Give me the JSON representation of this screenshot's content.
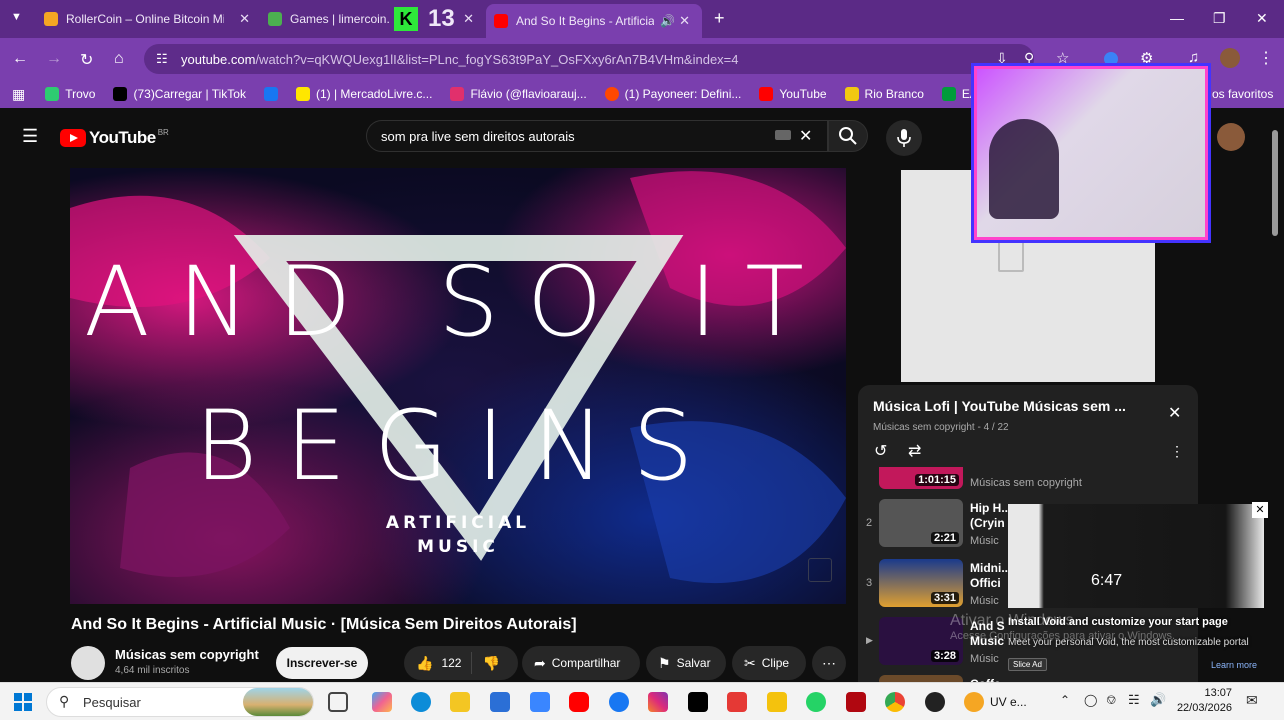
{
  "browser": {
    "tabs": [
      {
        "title": "RollerCoin – Online Bitcoin Min",
        "color": "#f5a623"
      },
      {
        "title": "Games | limercoin.c",
        "color": "#4caf50"
      },
      {
        "title": "And So It Begins - Artificial",
        "color": "#ff0000"
      }
    ],
    "overlay_counter": "13",
    "url_host": "youtube.com",
    "url_path": "/watch?v=qKWQUexg1lI&list=PLnc_fogYS63t9PaY_OsFXxy6rAn7B4VHm&index=4",
    "bookmarks": [
      {
        "label": "Trovo",
        "color": "#2ecc71"
      },
      {
        "label": "(73)Carregar | TikTok",
        "color": "#000000"
      },
      {
        "label": "",
        "color": "#1877f2"
      },
      {
        "label": "(1) | MercadoLivre.c...",
        "color": "#ffe600"
      },
      {
        "label": "Flávio (@flavioarauj...",
        "color": "#e1306c"
      },
      {
        "label": "(1) Payoneer: Defini...",
        "color": "#ff4800"
      },
      {
        "label": "YouTube",
        "color": "#ff0000"
      },
      {
        "label": "Rio Branco",
        "color": "#f2c811"
      },
      {
        "label": "EAD Cursos",
        "color": "#009c3b"
      }
    ],
    "bookmarks_right": "os favoritos"
  },
  "youtube": {
    "logo_text": "YouTube",
    "country": "BR",
    "search_query": "som pra live sem direitos autorais",
    "video_art": {
      "line1": "AND SO IT",
      "line2": "BEGINS",
      "sub1": "ARTIFICIAL",
      "sub2": "MUSIC"
    },
    "video_title": "And So It Begins - Artificial Music · [Música Sem Direitos Autorais]",
    "channel_name": "Músicas sem copyright",
    "subscribers": "4,64 mil inscritos",
    "subscribe_label": "Inscrever-se",
    "like_count": "122",
    "share_label": "Compartilhar",
    "save_label": "Salvar",
    "clip_label": "Clipe"
  },
  "playlist": {
    "title": "Música Lofi | YouTube Músicas sem ...",
    "subtitle": "Músicas sem copyright - 4 / 22",
    "items": [
      {
        "num": "",
        "duration": "1:01:15",
        "title": "",
        "channel": "Músicas sem copyright",
        "color": "#c2185b"
      },
      {
        "num": "2",
        "duration": "2:21",
        "title": "Hip H... (Cryin",
        "channel": "Músic",
        "color": "#555555"
      },
      {
        "num": "3",
        "duration": "3:31",
        "title": "Midni... Offici",
        "channel": "Músic",
        "color": "#1a3a8c"
      },
      {
        "num": "",
        "duration": "3:28",
        "title": "And S Music",
        "channel": "Músic",
        "color": "#2a1040"
      },
      {
        "num": "",
        "duration": "",
        "title": "Coffe",
        "channel": "",
        "color": "#6b4a2a"
      }
    ]
  },
  "popup": {
    "time": "6:47",
    "headline": "Install Void and customize your start page",
    "body": "Meet your personal Void, the most customizable portal",
    "badge": "Slice Ad",
    "learn_more": "Learn more",
    "watermark1": "Ativar o Windows",
    "watermark2": "Acesse Configurações para ativar o Windows."
  },
  "taskbar": {
    "search_placeholder": "Pesquisar",
    "app_label": "UV e...",
    "time": "13:07",
    "date": "22/03/2026"
  }
}
